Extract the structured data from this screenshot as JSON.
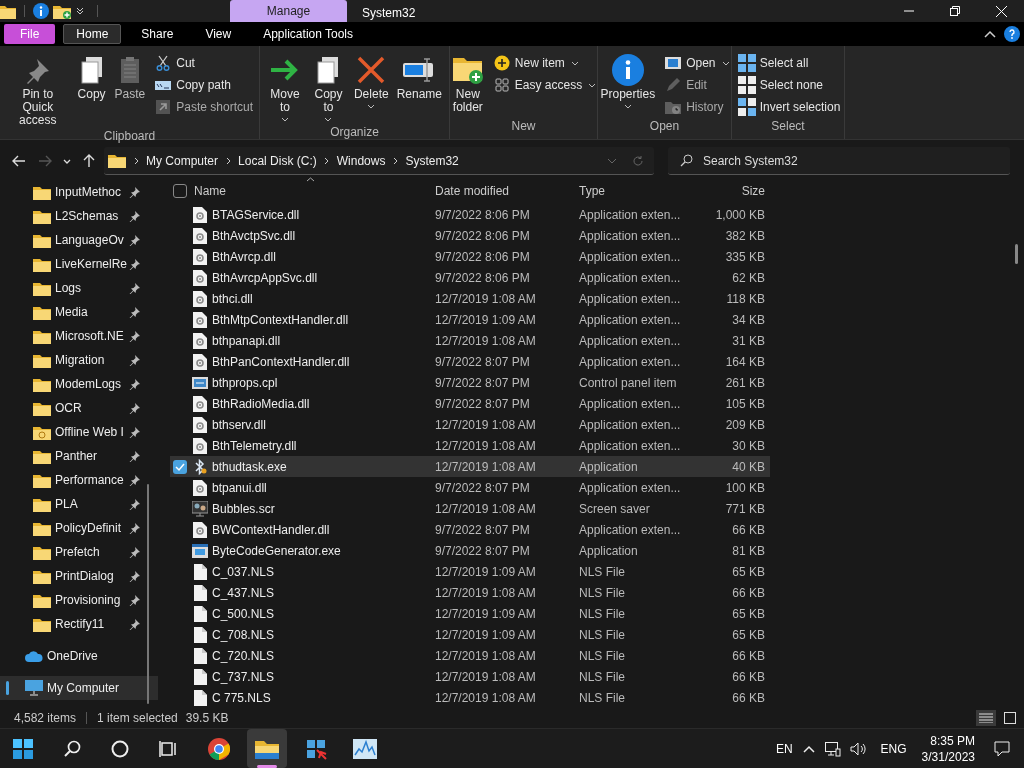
{
  "title_bar": {
    "context_tab": "Manage",
    "title": "System32"
  },
  "ribbon_tabs": [
    {
      "label": "File",
      "kind": "file",
      "selected": false
    },
    {
      "label": "Home",
      "kind": "tab",
      "selected": true
    },
    {
      "label": "Share",
      "kind": "tab",
      "selected": false
    },
    {
      "label": "View",
      "kind": "tab",
      "selected": false
    },
    {
      "label": "Application Tools",
      "kind": "tab",
      "selected": false
    }
  ],
  "ribbon_groups": [
    {
      "label": "Clipboard",
      "commands": [
        {
          "label": "Pin to Quick access",
          "kind": "large",
          "menu": false,
          "disabled": false
        },
        {
          "label": "Copy",
          "kind": "large",
          "menu": false,
          "disabled": false
        },
        {
          "label": "Paste",
          "kind": "large",
          "menu": false,
          "disabled": true
        },
        {
          "label": "Cut",
          "kind": "small",
          "menu": false,
          "disabled": false
        },
        {
          "label": "Copy path",
          "kind": "small",
          "menu": false,
          "disabled": false
        },
        {
          "label": "Paste shortcut",
          "kind": "small",
          "menu": false,
          "disabled": true
        }
      ]
    },
    {
      "label": "Organize",
      "commands": [
        {
          "label": "Move to",
          "kind": "large",
          "menu": true,
          "disabled": false
        },
        {
          "label": "Copy to",
          "kind": "large",
          "menu": true,
          "disabled": false
        },
        {
          "label": "Delete",
          "kind": "large",
          "menu": true,
          "disabled": false
        },
        {
          "label": "Rename",
          "kind": "large",
          "menu": false,
          "disabled": false
        }
      ]
    },
    {
      "label": "New",
      "commands": [
        {
          "label": "New folder",
          "kind": "large",
          "menu": false,
          "disabled": false
        },
        {
          "label": "New item",
          "kind": "small",
          "menu": true,
          "disabled": false
        },
        {
          "label": "Easy access",
          "kind": "small",
          "menu": true,
          "disabled": false
        }
      ]
    },
    {
      "label": "Open",
      "commands": [
        {
          "label": "Properties",
          "kind": "large",
          "menu": true,
          "disabled": false
        },
        {
          "label": "Open",
          "kind": "small",
          "menu": true,
          "disabled": false
        },
        {
          "label": "Edit",
          "kind": "small",
          "menu": false,
          "disabled": true
        },
        {
          "label": "History",
          "kind": "small",
          "menu": false,
          "disabled": true
        }
      ]
    },
    {
      "label": "Select",
      "commands": [
        {
          "label": "Select all",
          "kind": "small",
          "menu": false,
          "disabled": false
        },
        {
          "label": "Select none",
          "kind": "small",
          "menu": false,
          "disabled": false
        },
        {
          "label": "Invert selection",
          "kind": "small",
          "menu": false,
          "disabled": false
        }
      ]
    }
  ],
  "address_bar": {
    "forward_disabled": true,
    "breadcrumb": [
      "My Computer",
      "Local Disk (C:)",
      "Windows",
      "System32"
    ],
    "search": {
      "placeholder": "Search System32"
    }
  },
  "sidebar": {
    "items": [
      {
        "label": "InputMethoc",
        "kind": "folder",
        "pinned": true,
        "selected": false
      },
      {
        "label": "L2Schemas",
        "kind": "folder",
        "pinned": true,
        "selected": false
      },
      {
        "label": "LanguageOv",
        "kind": "folder",
        "pinned": true,
        "selected": false
      },
      {
        "label": "LiveKernelRe",
        "kind": "folder",
        "pinned": true,
        "selected": false
      },
      {
        "label": "Logs",
        "kind": "folder",
        "pinned": true,
        "selected": false
      },
      {
        "label": "Media",
        "kind": "folder",
        "pinned": true,
        "selected": false
      },
      {
        "label": "Microsoft.NE",
        "kind": "folder",
        "pinned": true,
        "selected": false
      },
      {
        "label": "Migration",
        "kind": "folder",
        "pinned": true,
        "selected": false
      },
      {
        "label": "ModemLogs",
        "kind": "folder",
        "pinned": true,
        "selected": false
      },
      {
        "label": "OCR",
        "kind": "folder",
        "pinned": true,
        "selected": false
      },
      {
        "label": "Offline Web I",
        "kind": "offline",
        "pinned": true,
        "selected": false
      },
      {
        "label": "Panther",
        "kind": "folder",
        "pinned": true,
        "selected": false
      },
      {
        "label": "Performance",
        "kind": "folder",
        "pinned": true,
        "selected": false
      },
      {
        "label": "PLA",
        "kind": "folder",
        "pinned": true,
        "selected": false
      },
      {
        "label": "PolicyDefinit",
        "kind": "folder",
        "pinned": true,
        "selected": false
      },
      {
        "label": "Prefetch",
        "kind": "folder",
        "pinned": true,
        "selected": false
      },
      {
        "label": "PrintDialog",
        "kind": "folder",
        "pinned": true,
        "selected": false
      },
      {
        "label": "Provisioning",
        "kind": "folder",
        "pinned": true,
        "selected": false
      },
      {
        "label": "Rectify11",
        "kind": "folder",
        "pinned": true,
        "selected": false
      },
      {
        "label": "OneDrive",
        "kind": "cloud",
        "pinned": false,
        "selected": false
      },
      {
        "label": "My Computer",
        "kind": "computer",
        "pinned": false,
        "selected": true
      }
    ]
  },
  "file_list": {
    "select_all_checked": false,
    "columns": [
      "Name",
      "Date modified",
      "Type",
      "Size"
    ],
    "rows": [
      {
        "name": "BTAGService.dll",
        "date": "9/7/2022 8:06 PM",
        "type": "Application exten...",
        "size": "1,000 KB",
        "kind": "dll",
        "selected": false
      },
      {
        "name": "BthAvctpSvc.dll",
        "date": "9/7/2022 8:06 PM",
        "type": "Application exten...",
        "size": "382 KB",
        "kind": "dll",
        "selected": false
      },
      {
        "name": "BthAvrcp.dll",
        "date": "9/7/2022 8:06 PM",
        "type": "Application exten...",
        "size": "335 KB",
        "kind": "dll",
        "selected": false
      },
      {
        "name": "BthAvrcpAppSvc.dll",
        "date": "9/7/2022 8:06 PM",
        "type": "Application exten...",
        "size": "62 KB",
        "kind": "dll",
        "selected": false
      },
      {
        "name": "bthci.dll",
        "date": "12/7/2019 1:08 AM",
        "type": "Application exten...",
        "size": "118 KB",
        "kind": "dll",
        "selected": false
      },
      {
        "name": "BthMtpContextHandler.dll",
        "date": "12/7/2019 1:09 AM",
        "type": "Application exten...",
        "size": "34 KB",
        "kind": "dll",
        "selected": false
      },
      {
        "name": "bthpanapi.dll",
        "date": "12/7/2019 1:08 AM",
        "type": "Application exten...",
        "size": "31 KB",
        "kind": "dll",
        "selected": false
      },
      {
        "name": "BthPanContextHandler.dll",
        "date": "9/7/2022 8:07 PM",
        "type": "Application exten...",
        "size": "164 KB",
        "kind": "dll",
        "selected": false
      },
      {
        "name": "bthprops.cpl",
        "date": "9/7/2022 8:07 PM",
        "type": "Control panel item",
        "size": "261 KB",
        "kind": "cpl",
        "selected": false
      },
      {
        "name": "BthRadioMedia.dll",
        "date": "9/7/2022 8:07 PM",
        "type": "Application exten...",
        "size": "105 KB",
        "kind": "dll",
        "selected": false
      },
      {
        "name": "bthserv.dll",
        "date": "12/7/2019 1:08 AM",
        "type": "Application exten...",
        "size": "209 KB",
        "kind": "dll",
        "selected": false
      },
      {
        "name": "BthTelemetry.dll",
        "date": "12/7/2019 1:08 AM",
        "type": "Application exten...",
        "size": "30 KB",
        "kind": "dll",
        "selected": false
      },
      {
        "name": "bthudtask.exe",
        "date": "12/7/2019 1:08 AM",
        "type": "Application",
        "size": "40 KB",
        "kind": "bluetooth",
        "selected": true
      },
      {
        "name": "btpanui.dll",
        "date": "9/7/2022 8:07 PM",
        "type": "Application exten...",
        "size": "100 KB",
        "kind": "dll",
        "selected": false
      },
      {
        "name": "Bubbles.scr",
        "date": "12/7/2019 1:08 AM",
        "type": "Screen saver",
        "size": "771 KB",
        "kind": "scr",
        "selected": false
      },
      {
        "name": "BWContextHandler.dll",
        "date": "9/7/2022 8:07 PM",
        "type": "Application exten...",
        "size": "66 KB",
        "kind": "dll",
        "selected": false
      },
      {
        "name": "ByteCodeGenerator.exe",
        "date": "9/7/2022 8:07 PM",
        "type": "Application",
        "size": "81 KB",
        "kind": "exe",
        "selected": false
      },
      {
        "name": "C_037.NLS",
        "date": "12/7/2019 1:09 AM",
        "type": "NLS File",
        "size": "65 KB",
        "kind": "file",
        "selected": false
      },
      {
        "name": "C_437.NLS",
        "date": "12/7/2019 1:08 AM",
        "type": "NLS File",
        "size": "66 KB",
        "kind": "file",
        "selected": false
      },
      {
        "name": "C_500.NLS",
        "date": "12/7/2019 1:09 AM",
        "type": "NLS File",
        "size": "65 KB",
        "kind": "file",
        "selected": false
      },
      {
        "name": "C_708.NLS",
        "date": "12/7/2019 1:09 AM",
        "type": "NLS File",
        "size": "65 KB",
        "kind": "file",
        "selected": false
      },
      {
        "name": "C_720.NLS",
        "date": "12/7/2019 1:08 AM",
        "type": "NLS File",
        "size": "66 KB",
        "kind": "file",
        "selected": false
      },
      {
        "name": "C_737.NLS",
        "date": "12/7/2019 1:08 AM",
        "type": "NLS File",
        "size": "66 KB",
        "kind": "file",
        "selected": false
      },
      {
        "name": "C 775.NLS",
        "date": "12/7/2019 1:08 AM",
        "type": "NLS File",
        "size": "66 KB",
        "kind": "file",
        "selected": false
      }
    ]
  },
  "status_bar": {
    "item_count": "4,582 items",
    "selection": "1 item selected",
    "selection_size": "39.5 KB"
  },
  "taskbar": {
    "apps": [
      {
        "kind": "start",
        "active": false
      },
      {
        "kind": "search",
        "active": false
      },
      {
        "kind": "cortana",
        "active": false
      },
      {
        "kind": "taskview",
        "active": false
      },
      {
        "kind": "browser",
        "active": false
      },
      {
        "kind": "explorer",
        "active": true
      },
      {
        "kind": "app",
        "active": false
      },
      {
        "kind": "monitor",
        "active": false
      }
    ],
    "tray": {
      "input": "EN",
      "language": "ENG",
      "time": "8:35 PM",
      "date": "3/31/2023"
    }
  }
}
